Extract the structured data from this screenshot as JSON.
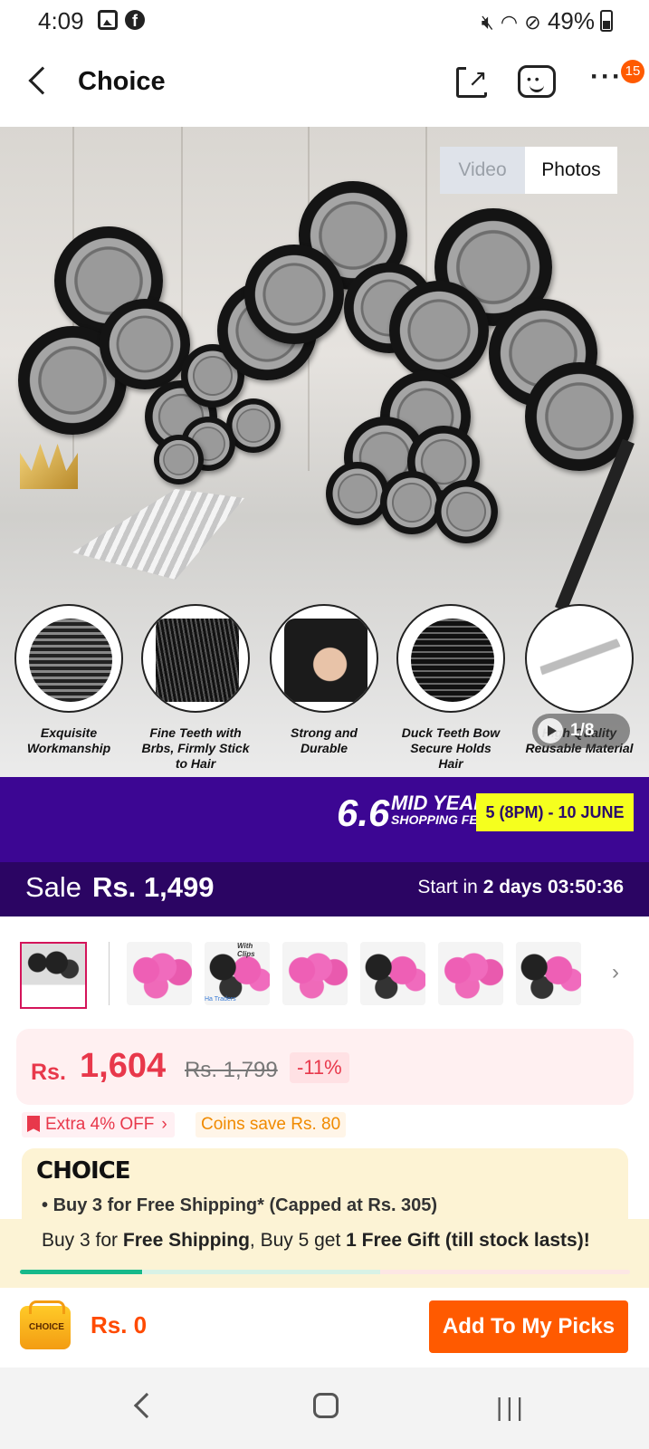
{
  "status_bar": {
    "time": "4:09",
    "battery": "49%",
    "icons": [
      "gallery-icon",
      "facebook-icon",
      "mute-icon",
      "wifi-icon",
      "dnd-icon",
      "battery-icon"
    ]
  },
  "header": {
    "title": "Choice",
    "notification_count": "15"
  },
  "gallery": {
    "toggle_video": "Video",
    "toggle_photos": "Photos",
    "counter": "1/8",
    "features": [
      "Exquisite Workmanship",
      "Fine Teeth with Brbs, Firmly Stick to Hair",
      "Strong and Durable",
      "Duck Teeth Bow Secure Holds Hair",
      "High Quality Reusable Material"
    ]
  },
  "promo": {
    "number": "6.6",
    "title_main": "MID YEAR",
    "title_sub": "SHOPPING FEST!",
    "dates": "5 (8PM) - 10 JUNE"
  },
  "sale": {
    "label": "Sale",
    "price": "Rs. 1,499",
    "start_prefix": "Start in",
    "start_days": "2 days",
    "countdown": "03:50:36"
  },
  "thumbnails": {
    "label_with_clips": "With Clips",
    "label_traders": "Ha Traders"
  },
  "price": {
    "currency": "Rs.",
    "current": "1,604",
    "original": "Rs. 1,799",
    "discount": "-11%"
  },
  "offers": {
    "extra_off": "Extra 4% OFF",
    "coins_save": "Coins save Rs. 80"
  },
  "choice": {
    "logo": "CHOICE",
    "bullet": "Buy 3 for  Free Shipping* (Capped at Rs. 305)"
  },
  "shipping_banner": {
    "part1": "Buy 3 for ",
    "bold1": "Free Shipping",
    "part2": ", Buy 5 get ",
    "bold2": "1 Free Gift (till stock lasts)!",
    "progress_fraction": 0.2
  },
  "action_bar": {
    "cart_label": "CHOICE",
    "cart_amount": "Rs. 0",
    "add_button": "Add To My Picks"
  },
  "colors": {
    "accent": "#ff5a00",
    "price_red": "#e8384b",
    "promo_purple": "#3c0693",
    "progress_green": "#17b98a"
  }
}
